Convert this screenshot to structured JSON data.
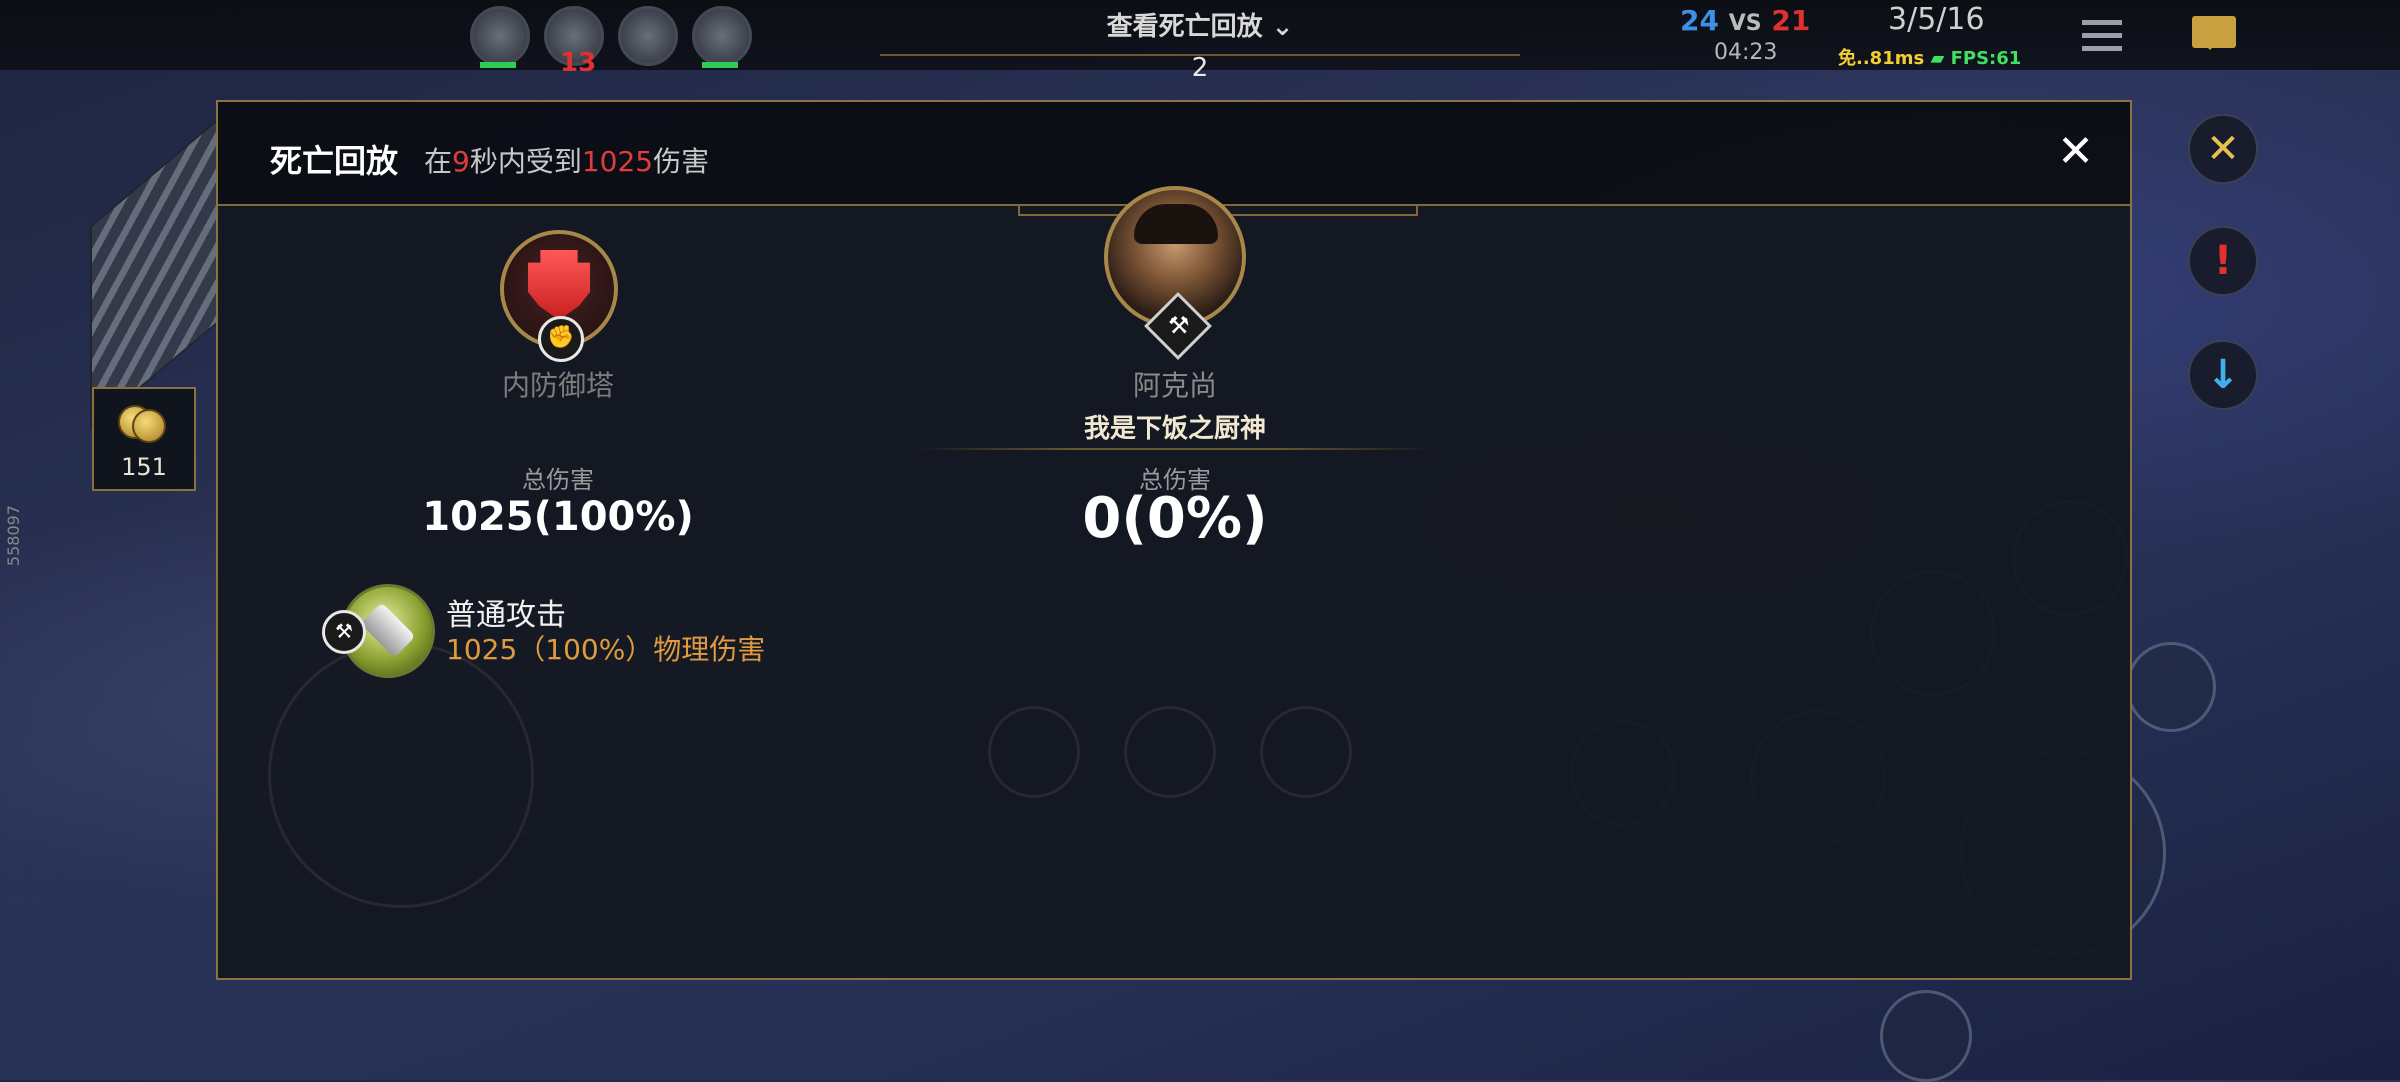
{
  "top_bar": {
    "damage_number": "13",
    "replay_title": "查看死亡回放",
    "replay_count": "2",
    "score_blue": "24",
    "score_vs": "VS",
    "score_red": "21",
    "timer": "04:23",
    "kda": "3/5/16",
    "ping": "免..81ms",
    "fps": "FPS:61"
  },
  "left_hud": {
    "gold": "151",
    "vertical_text": "558097"
  },
  "right_hud": {
    "icons": [
      "crossed-swords-icon",
      "alert-icon",
      "arrow-down-icon"
    ],
    "colors": {
      "crossed": "#e8c050",
      "alert": "#e03030",
      "arrow": "#40b0e8"
    }
  },
  "death_replay": {
    "title": "死亡回放",
    "summary_prefix": "在",
    "summary_seconds": "9",
    "summary_mid": "秒内受到",
    "summary_damage": "1025",
    "summary_suffix": "伤害",
    "close_glyph": "✕",
    "sources": [
      {
        "name": "内防御塔",
        "player_name": "",
        "total_label": "总伤害",
        "total_value": "1025(100%)",
        "badge_icon": "fist-icon"
      },
      {
        "name": "阿克尚",
        "player_name": "我是下饭之厨神",
        "total_label": "总伤害",
        "total_value": "0(0%)",
        "badge_icon": "hammer-crossed-icon"
      }
    ],
    "skills": [
      {
        "name": "普通攻击",
        "detail": "1025（100%）物理伤害",
        "badge_icon": "hammer-crossed-icon"
      }
    ]
  },
  "colors": {
    "highlight_red": "#e03c3c",
    "damage_orange": "#e09a40",
    "gold_border": "#8a7244",
    "team_blue": "#3d8fe8",
    "team_red": "#e03030"
  }
}
